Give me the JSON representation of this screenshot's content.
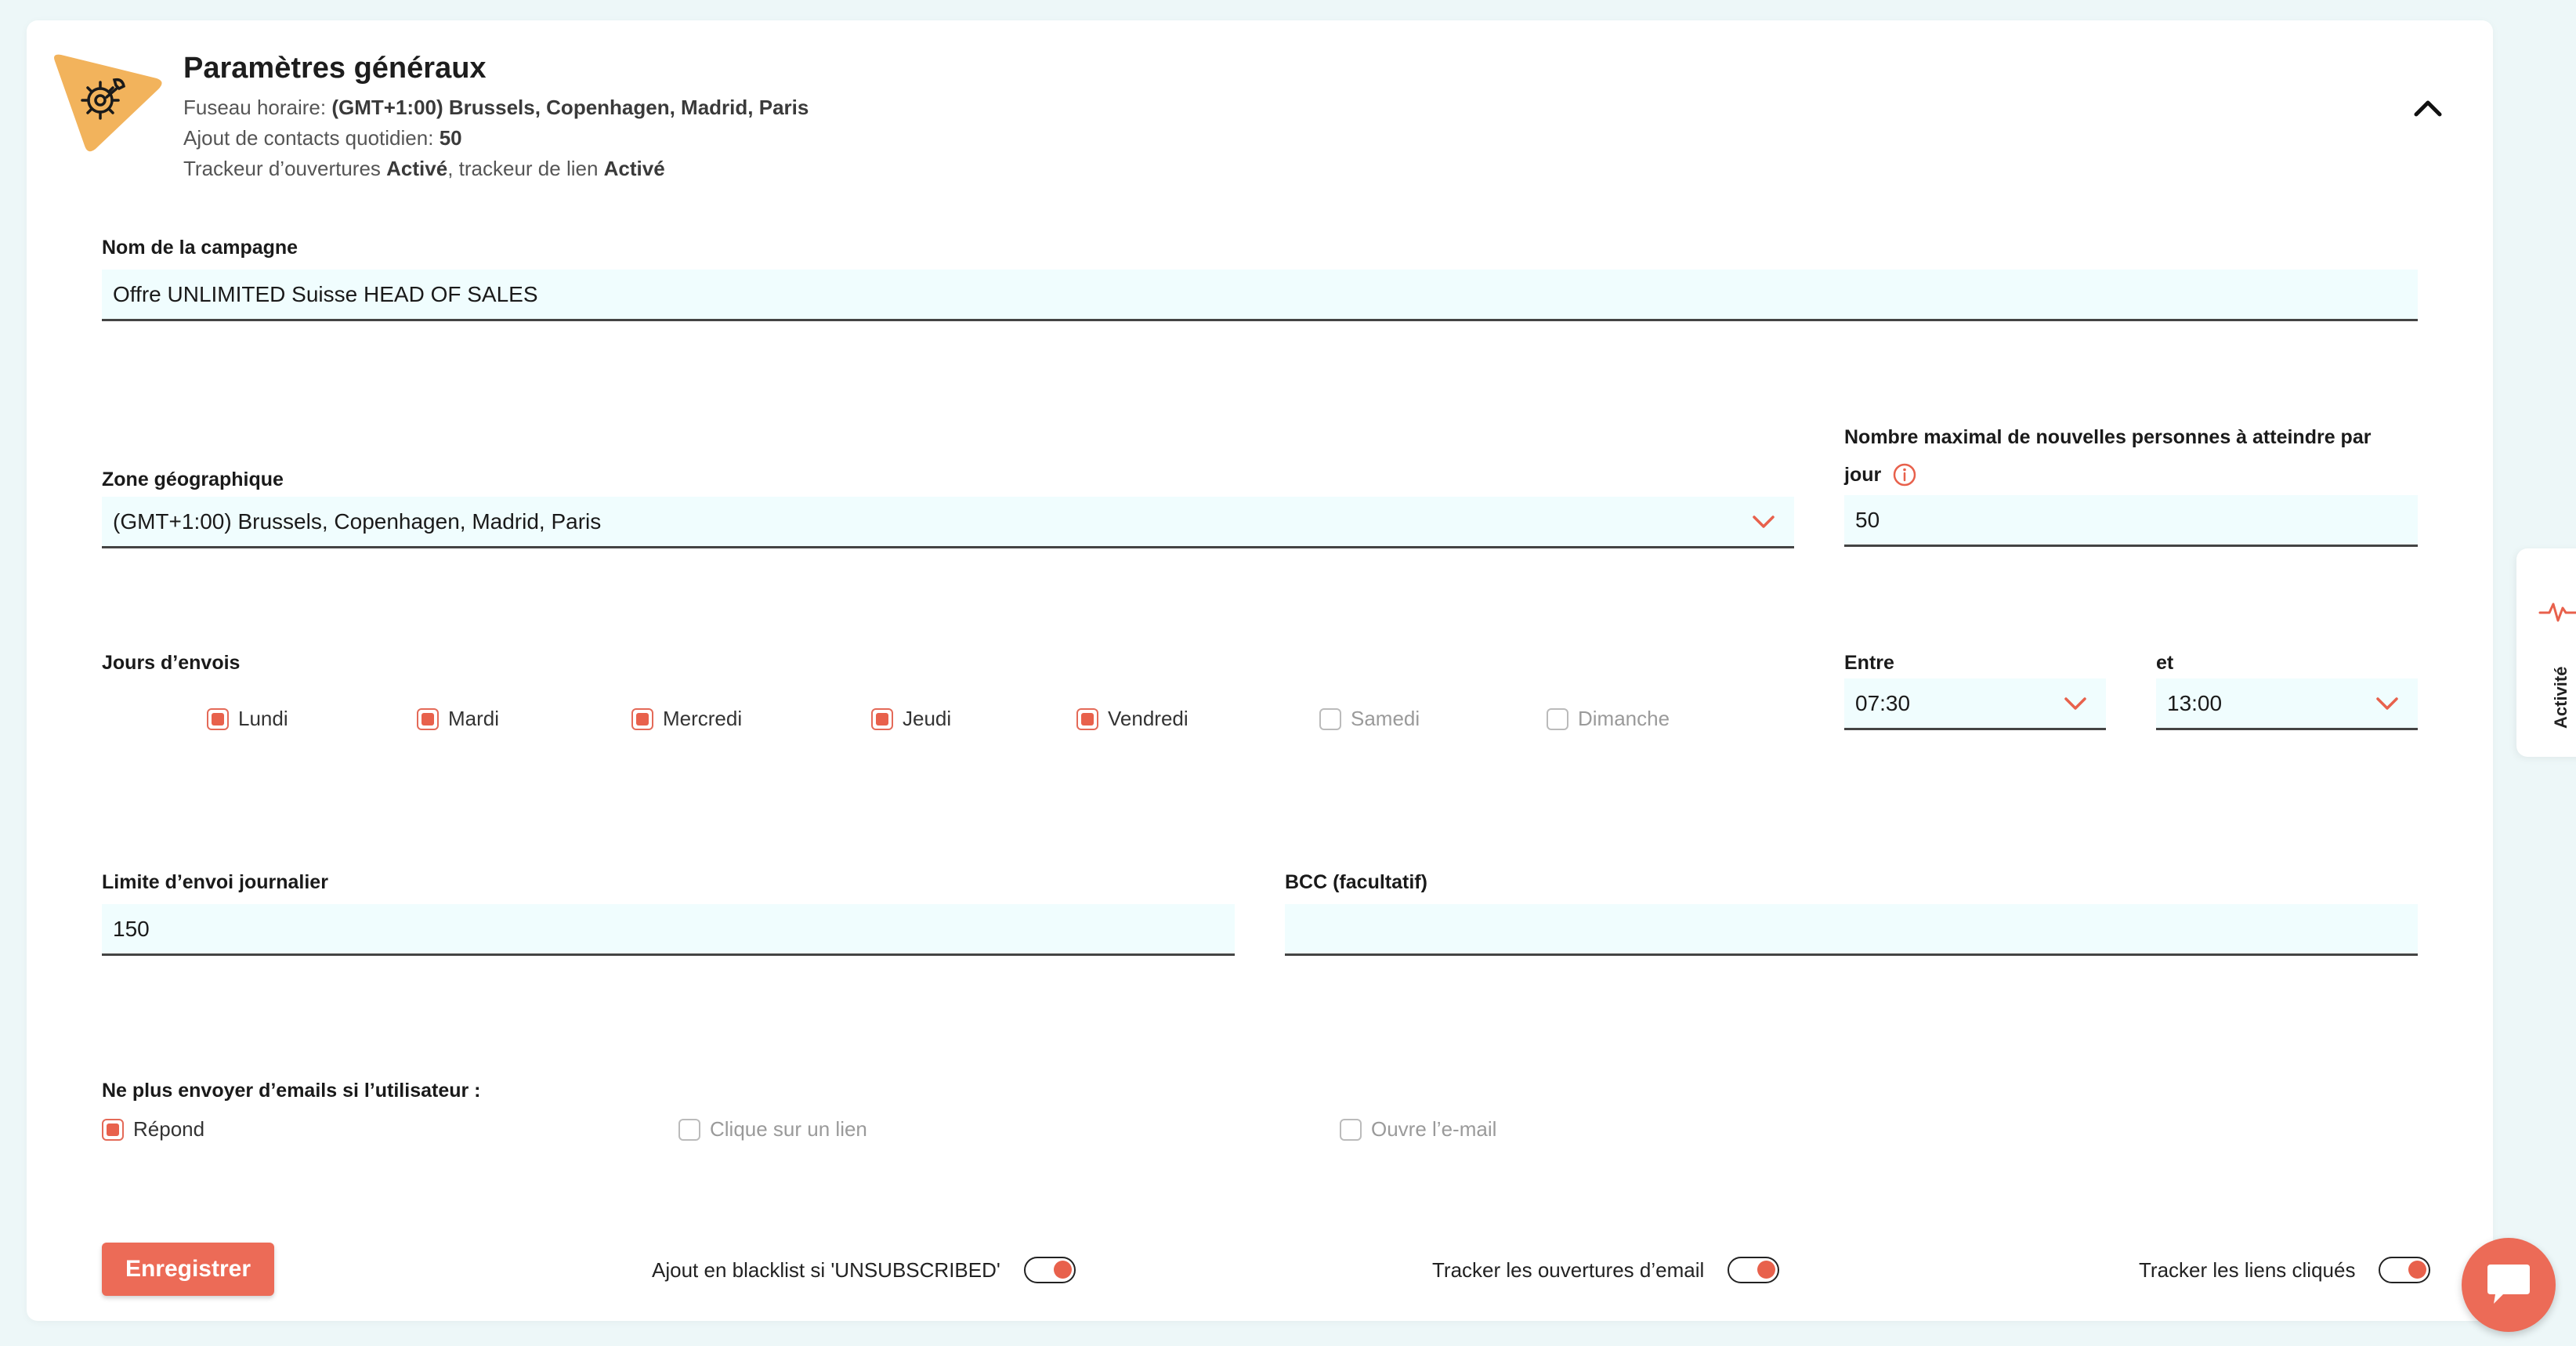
{
  "header": {
    "title": "Paramètres généraux",
    "timezone_label": "Fuseau horaire:",
    "timezone_value": "(GMT+1:00) Brussels, Copenhagen, Madrid, Paris",
    "daily_contacts_label": "Ajout de contacts quotidien:",
    "daily_contacts_value": "50",
    "tracker_prefix": "Trackeur d’ouvertures",
    "tracker_open_value": "Activé",
    "tracker_link_mid": ", trackeur de lien",
    "tracker_link_value": "Activé",
    "logo_icon": "gear-wrench-icon",
    "collapse_icon": "chevron-up-icon"
  },
  "campaign": {
    "label": "Nom de la campagne",
    "value": "Offre UNLIMITED Suisse HEAD OF SALES"
  },
  "zone": {
    "label": "Zone géographique",
    "value": "(GMT+1:00) Brussels, Copenhagen, Madrid, Paris"
  },
  "max_people": {
    "label_line1": "Nombre maximal de nouvelles personnes à atteindre par",
    "label_line2": "jour",
    "value": "50"
  },
  "days": {
    "label": "Jours d’envois",
    "items": [
      {
        "label": "Lundi",
        "checked": true
      },
      {
        "label": "Mardi",
        "checked": true
      },
      {
        "label": "Mercredi",
        "checked": true
      },
      {
        "label": "Jeudi",
        "checked": true
      },
      {
        "label": "Vendredi",
        "checked": true
      },
      {
        "label": "Samedi",
        "checked": false
      },
      {
        "label": "Dimanche",
        "checked": false
      }
    ]
  },
  "between": {
    "label": "Entre",
    "value": "07:30"
  },
  "and": {
    "label": "et",
    "value": "13:00"
  },
  "daily_limit": {
    "label": "Limite d’envoi journalier",
    "value": "150"
  },
  "bcc": {
    "label": "BCC (facultatif)",
    "value": ""
  },
  "stop": {
    "label": "Ne plus envoyer d’emails si l’utilisateur :",
    "items": [
      {
        "label": "Répond",
        "checked": true
      },
      {
        "label": "Clique sur un lien",
        "checked": false
      },
      {
        "label": "Ouvre l’e-mail",
        "checked": false
      }
    ]
  },
  "footer": {
    "save_label": "Enregistrer",
    "blacklist_label": "Ajout en blacklist si 'UNSUBSCRIBED'",
    "track_open_label": "Tracker les ouvertures d’email",
    "track_links_label": "Tracker les liens cliqués"
  },
  "side_tab": {
    "label": "Activité",
    "icon": "pulse-icon"
  },
  "chat": {
    "icon": "chat-bubble-icon"
  },
  "colors": {
    "accent": "#e8614c",
    "field_bg": "#f0fdfe",
    "logo": "#f2b35c"
  }
}
